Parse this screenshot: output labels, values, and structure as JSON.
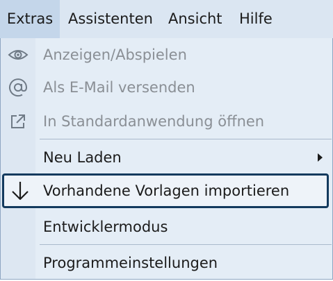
{
  "menubar": {
    "items": [
      {
        "label": "Extras"
      },
      {
        "label": "Assistenten"
      },
      {
        "label": "Ansicht"
      },
      {
        "label": "Hilfe"
      }
    ]
  },
  "dropdown": {
    "items": [
      {
        "label": "Anzeigen/Abspielen",
        "icon": "eye-icon",
        "enabled": false
      },
      {
        "label": "Als E-Mail versenden",
        "icon": "at-icon",
        "enabled": false
      },
      {
        "label": "In Standardanwendung öffnen",
        "icon": "external-link-icon",
        "enabled": false
      },
      {
        "label": "Neu Laden",
        "enabled": true,
        "submenu": true
      },
      {
        "label": "Vorhandene Vorlagen importieren",
        "icon": "arrow-down-icon",
        "enabled": true,
        "highlighted": true
      },
      {
        "label": "Entwicklermodus",
        "enabled": true
      },
      {
        "label": "Programmeinstellungen",
        "enabled": true
      }
    ]
  },
  "colors": {
    "menubar_bg": "#dbe6f2",
    "active_menu_bg": "#c4d6ea",
    "dropdown_bg": "#e4edf6",
    "disabled_text": "#8a8f95",
    "focus_border": "#133a5e"
  }
}
